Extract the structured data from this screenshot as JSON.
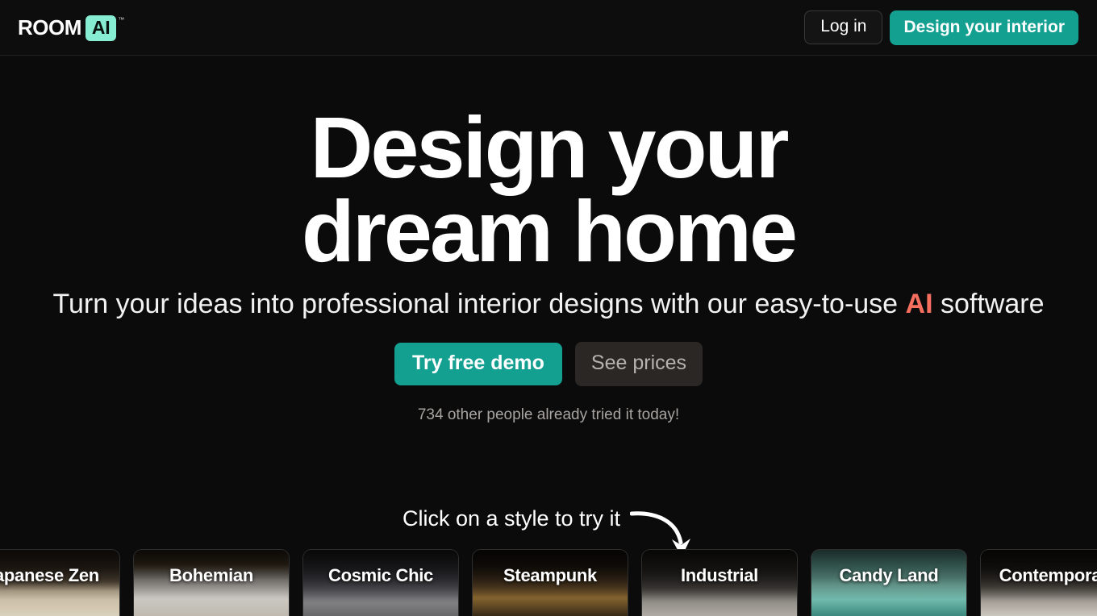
{
  "header": {
    "logo": {
      "word": "ROOM",
      "badge": "AI",
      "tm": "™"
    },
    "login_label": "Log in",
    "design_label": "Design your interior"
  },
  "hero": {
    "headline_line1": "Design your",
    "headline_line2": "dream home",
    "sub_before": "Turn your ideas into professional interior designs with our easy-to-use ",
    "sub_highlight": "AI",
    "sub_after": " software",
    "primary_cta": "Try free demo",
    "secondary_cta": "See prices",
    "social_proof": "734 other people already tried it today!"
  },
  "styles_section": {
    "prompt": "Click on a style to try it",
    "arrow_icon": "curved-arrow-down-right-icon",
    "cards": [
      {
        "label": "Japanese Zen",
        "photo": "ph-zen"
      },
      {
        "label": "Bohemian",
        "photo": "ph-boh"
      },
      {
        "label": "Cosmic Chic",
        "photo": "ph-cos"
      },
      {
        "label": "Steampunk",
        "photo": "ph-stm"
      },
      {
        "label": "Industrial",
        "photo": "ph-ind"
      },
      {
        "label": "Candy Land",
        "photo": "ph-can"
      },
      {
        "label": "Contemporary",
        "photo": "ph-con"
      }
    ]
  },
  "colors": {
    "background": "#0b0b0b",
    "accent_teal": "#13a091",
    "logo_mint": "#86ecd2",
    "ai_coral": "#f76f5f",
    "secondary_button": "#2a2725"
  }
}
